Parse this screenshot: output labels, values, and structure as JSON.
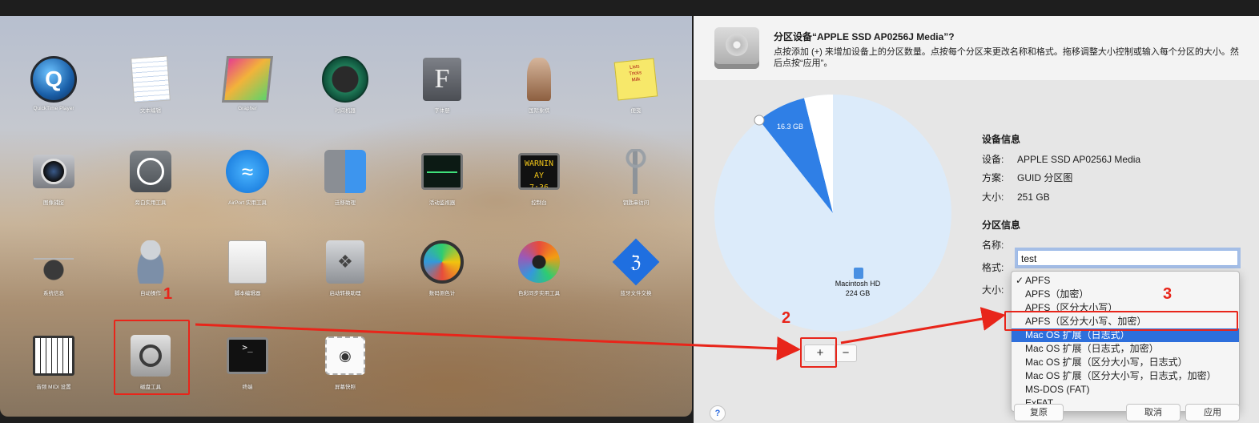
{
  "launchpad": {
    "apps": [
      {
        "label": "QuickTime Player",
        "icon": "quicktime-icon"
      },
      {
        "label": "文本编辑",
        "icon": "textedit-icon"
      },
      {
        "label": "Grapher",
        "icon": "grapher-icon"
      },
      {
        "label": "时间机器",
        "icon": "time-machine-icon"
      },
      {
        "label": "字体册",
        "icon": "font-book-icon"
      },
      {
        "label": "国际象棋",
        "icon": "chess-icon"
      },
      {
        "label": "便笺",
        "icon": "stickies-icon"
      },
      {
        "label": "图像捕捉",
        "icon": "image-capture-icon"
      },
      {
        "label": "旁白实用工具",
        "icon": "voiceover-icon"
      },
      {
        "label": "AirPort 实用工具",
        "icon": "airport-icon"
      },
      {
        "label": "迁移助理",
        "icon": "migration-assistant-icon"
      },
      {
        "label": "活动监视器",
        "icon": "activity-monitor-icon"
      },
      {
        "label": "控制台",
        "icon": "console-icon"
      },
      {
        "label": "钥匙串访问",
        "icon": "keychain-icon"
      },
      {
        "label": "系统信息",
        "icon": "system-information-icon"
      },
      {
        "label": "自动操作",
        "icon": "automator-icon"
      },
      {
        "label": "脚本编辑器",
        "icon": "script-editor-icon"
      },
      {
        "label": "启动转换助理",
        "icon": "boot-camp-icon"
      },
      {
        "label": "数码测色计",
        "icon": "digital-color-meter-icon"
      },
      {
        "label": "色彩同步实用工具",
        "icon": "colorsync-icon"
      },
      {
        "label": "蓝牙文件交换",
        "icon": "bluetooth-icon"
      },
      {
        "label": "音频 MIDI 设置",
        "icon": "audio-midi-icon"
      },
      {
        "label": "磁盘工具",
        "icon": "disk-utility-icon"
      },
      {
        "label": "终端",
        "icon": "terminal-icon"
      },
      {
        "label": "屏幕快照",
        "icon": "screenshot-icon"
      }
    ],
    "console_icon_text": [
      "WARNIN",
      "AY 7:36"
    ],
    "stickies_text": [
      "Lists",
      "Tricks",
      "Milk"
    ]
  },
  "annotations": {
    "step1": "1",
    "step2": "2",
    "step3": "3",
    "color": "#e8251a"
  },
  "sheet": {
    "title": "分区设备“APPLE SSD AP0256J Media”?",
    "description": "点按添加 (+) 来增加设备上的分区数量。点按每个分区来更改名称和格式。拖移调整大小控制或输入每个分区的大小。然后点按“应用”。",
    "pie": {
      "main_name": "Macintosh HD",
      "main_size": "224 GB",
      "small_size": "16.3 GB",
      "main_color": "#dcebfa",
      "small_color": "#2f7fe6"
    },
    "add_button": "+",
    "remove_button": "−",
    "device_info": {
      "heading": "设备信息",
      "device_key": "设备:",
      "device_val": "APPLE SSD AP0256J Media",
      "scheme_key": "方案:",
      "scheme_val": "GUID 分区图",
      "size_key": "大小:",
      "size_val": "251 GB"
    },
    "partition_info": {
      "heading": "分区信息",
      "name_key": "名称:",
      "name_value": "test",
      "format_key": "格式:",
      "size_key": "大小:"
    },
    "format_options": [
      {
        "label": "APFS",
        "checked": true
      },
      {
        "label": "APFS（加密）"
      },
      {
        "label": "APFS（区分大小写）"
      },
      {
        "label": "APFS（区分大小写、加密）"
      },
      {
        "label": "Mac OS 扩展（日志式）",
        "selected": true
      },
      {
        "label": "Mac OS 扩展（日志式，加密）"
      },
      {
        "label": "Mac OS 扩展（区分大小写，日志式）"
      },
      {
        "label": "Mac OS 扩展（区分大小写，日志式，加密）"
      },
      {
        "label": "MS-DOS (FAT)"
      },
      {
        "label": "ExFAT"
      }
    ],
    "checkmark": "✓",
    "help": "?",
    "bottom_buttons": [
      "复原",
      "取消",
      "应用"
    ]
  }
}
